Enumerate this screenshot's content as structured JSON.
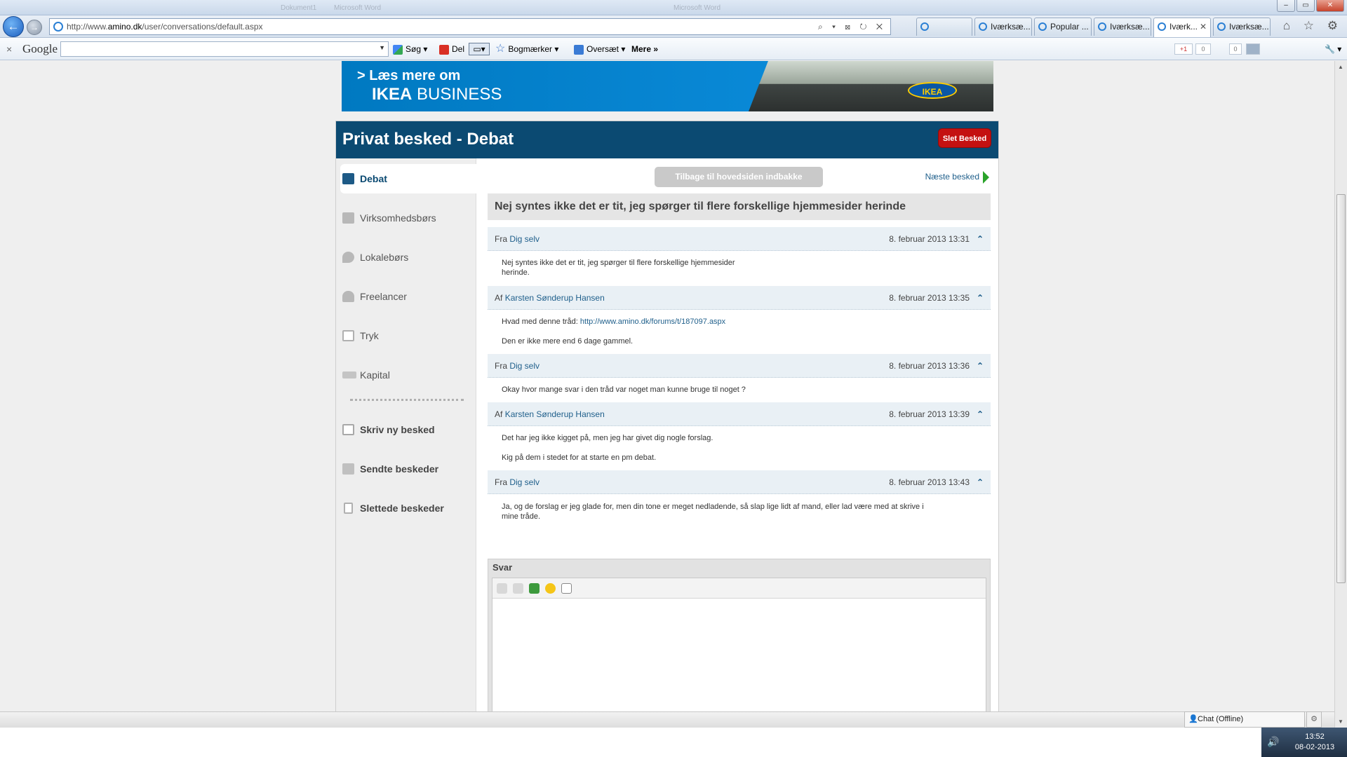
{
  "browser": {
    "url_prefix": "http://www.",
    "url_domain": "amino.dk",
    "url_path": "/user/conversations/default.aspx",
    "address_tools": "⌕ ▾ ⊠ ↻ ✕",
    "ghost_titles": [
      "Dokument1",
      "Microsoft Word",
      "Microsoft Word"
    ],
    "tabs": [
      {
        "label": "",
        "active": false
      },
      {
        "label": "Iværksæ...",
        "active": false
      },
      {
        "label": "Popular ...",
        "active": false
      },
      {
        "label": "Iværksæ...",
        "active": false
      },
      {
        "label": "Iværk...",
        "active": true
      },
      {
        "label": "Iværksæ...",
        "active": false
      }
    ],
    "window_controls": {
      "min": "‒",
      "max": "▭",
      "close": "✕"
    },
    "nav_icons": "⌂ ☆ ⚙"
  },
  "google_toolbar": {
    "close": "×",
    "logo": "Google",
    "search_placeholder": "",
    "items": [
      {
        "label": "Søg ▾"
      },
      {
        "label": "Del"
      },
      {
        "label": "Bogmærker ▾"
      },
      {
        "label": "Oversæt ▾"
      },
      {
        "label": "Mere »"
      }
    ],
    "plus_one": "+1",
    "count_a": "0",
    "count_b": "0",
    "wrench": "🔧 ▾"
  },
  "banner": {
    "line1": "> Læs mere om",
    "line2_bold": "IKEA",
    "line2_rest": " BUSINESS",
    "logo": "IKEA"
  },
  "page": {
    "title": "Privat besked - Debat",
    "delete_button": "Slet Besked",
    "back_button": "Tilbage til hovedsiden indbakke",
    "next_link": "Næste besked",
    "subject": "Nej syntes ikke det er tit, jeg spørger til flere forskellige hjemmesider herinde"
  },
  "sidebar": {
    "items": [
      {
        "label": "Debat",
        "icon": "chat-bubbles-icon"
      },
      {
        "label": "Virksomhedsbørs",
        "icon": "exchange-arrows-icon"
      },
      {
        "label": "Lokalebørs",
        "icon": "map-pin-icon"
      },
      {
        "label": "Freelancer",
        "icon": "person-icon"
      },
      {
        "label": "Tryk",
        "icon": "print-icon"
      },
      {
        "label": "Kapital",
        "icon": "money-icon"
      }
    ],
    "actions": [
      {
        "label": "Skriv ny besked",
        "icon": "compose-icon"
      },
      {
        "label": "Sendte beskeder",
        "icon": "sent-icon"
      },
      {
        "label": "Slettede beskeder",
        "icon": "trash-icon"
      }
    ]
  },
  "messages": [
    {
      "prefix": "Fra",
      "author": "Dig selv",
      "date": "8. februar 2013 13:31",
      "lines": [
        "Nej syntes ikke det er tit, jeg spørger til flere forskellige hjemmesider",
        "herinde."
      ]
    },
    {
      "prefix": "Af",
      "author": "Karsten Sønderup Hansen",
      "date": "8. februar 2013 13:35",
      "link_intro": "Hvad med denne tråd: ",
      "link": "http://www.amino.dk/forums/t/187097.aspx",
      "lines": [
        "Den er ikke mere end 6 dage gammel."
      ]
    },
    {
      "prefix": "Fra",
      "author": "Dig selv",
      "date": "8. februar 2013 13:36",
      "lines": [
        "Okay hvor mange svar i den tråd var noget man kunne bruge til noget ?"
      ]
    },
    {
      "prefix": "Af",
      "author": "Karsten Sønderup Hansen",
      "date": "8. februar 2013 13:39",
      "lines": [
        "Det har jeg ikke kigget på, men jeg har givet dig nogle forslag.",
        "Kig på dem i stedet for at starte en pm debat."
      ]
    },
    {
      "prefix": "Fra",
      "author": "Dig selv",
      "date": "8. februar 2013 13:43",
      "lines": [
        "Ja, og de forslag er jeg glade for, men din tone er meget nedladende, så slap lige lidt af mand, eller lad være med at skrive i",
        "mine tråde."
      ]
    }
  ],
  "up_arrow": "⌃",
  "reply": {
    "label": "Svar"
  },
  "statusbar": {
    "chat": "Chat (Offline)",
    "gear": "⚙"
  },
  "tray": {
    "time": "13:52",
    "date": "08-02-2013",
    "volume": "🔊"
  }
}
